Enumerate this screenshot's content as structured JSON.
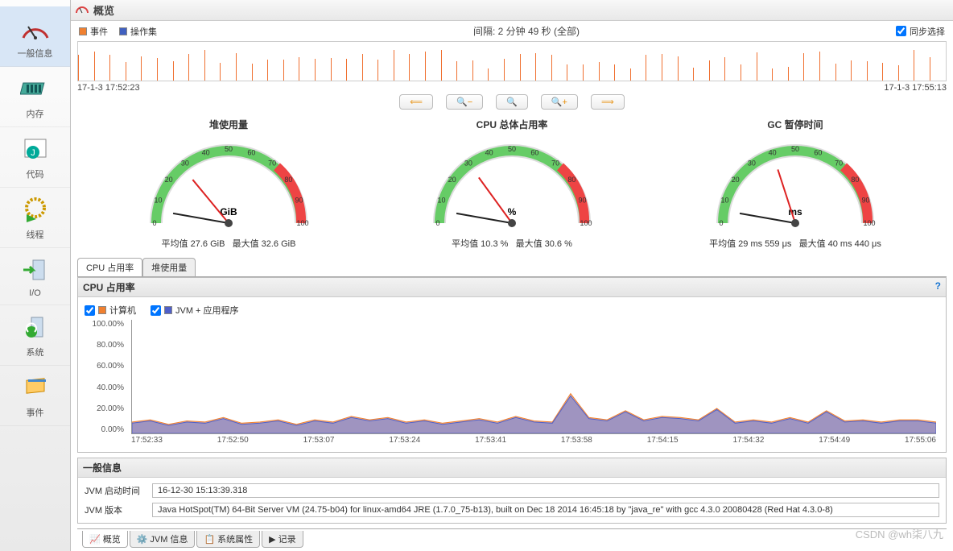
{
  "title": "概览",
  "sidebar": {
    "items": [
      {
        "label": "一般信息"
      },
      {
        "label": "内存"
      },
      {
        "label": "代码"
      },
      {
        "label": "线程"
      },
      {
        "label": "I/O"
      },
      {
        "label": "系统"
      },
      {
        "label": "事件"
      }
    ]
  },
  "legend": {
    "events": "事件",
    "opsets": "操作集",
    "interval": "间隔: 2 分钟 49 秒 (全部)",
    "sync": "同步选择"
  },
  "timeline": {
    "start": "17-1-3 17:52:23",
    "end": "17-1-3 17:55:13"
  },
  "gauges": [
    {
      "title": "堆使用量",
      "unit": "GiB",
      "avg": "平均值 27.6 GiB",
      "max": "最大值 32.6 GiB",
      "needle": 28,
      "max_scale": 100
    },
    {
      "title": "CPU 总体占用率",
      "unit": "%",
      "avg": "平均值 10.3 %",
      "max": "最大值 30.6 %",
      "needle": 30,
      "max_scale": 100
    },
    {
      "title": "GC 暂停时间",
      "unit": "ms",
      "avg": "平均值 29 ms 559 μs",
      "max": "最大值 40 ms 440 μs",
      "needle": 40,
      "max_scale": 100
    }
  ],
  "chart_tabs": [
    {
      "label": "CPU 占用率",
      "active": true
    },
    {
      "label": "堆使用量",
      "active": false
    }
  ],
  "chart_panel": {
    "title": "CPU 占用率",
    "series_labels": {
      "computer": "计算机",
      "jvm": "JVM + 应用程序"
    }
  },
  "chart_data": {
    "type": "area",
    "title": "CPU 占用率",
    "ylabel": "%",
    "ylim": [
      0,
      100
    ],
    "x_ticks": [
      "17:52:33",
      "17:52:50",
      "17:53:07",
      "17:53:24",
      "17:53:41",
      "17:53:58",
      "17:54:15",
      "17:54:32",
      "17:54:49",
      "17:55:06"
    ],
    "series": [
      {
        "name": "计算机",
        "color": "#f08030",
        "values": [
          10,
          12,
          8,
          11,
          10,
          14,
          9,
          10,
          12,
          8,
          12,
          10,
          15,
          12,
          14,
          10,
          12,
          9,
          11,
          13,
          10,
          15,
          11,
          10,
          35,
          14,
          12,
          20,
          12,
          15,
          14,
          12,
          22,
          10,
          12,
          10,
          14,
          10,
          20,
          11,
          12,
          10,
          12,
          12,
          10
        ]
      },
      {
        "name": "JVM + 应用程序",
        "color": "#5060c8",
        "values": [
          9,
          11,
          7,
          10,
          9,
          13,
          8,
          9,
          11,
          7,
          11,
          9,
          14,
          11,
          13,
          9,
          11,
          8,
          10,
          12,
          9,
          14,
          10,
          9,
          33,
          13,
          11,
          19,
          11,
          14,
          13,
          11,
          21,
          9,
          11,
          9,
          13,
          9,
          19,
          10,
          11,
          9,
          11,
          11,
          9
        ]
      }
    ]
  },
  "general_info": {
    "title": "一般信息",
    "rows": [
      {
        "label": "JVM 启动时间",
        "value": "16-12-30 15:13:39.318"
      },
      {
        "label": "JVM 版本",
        "value": "Java HotSpot(TM) 64-Bit Server VM (24.75-b04) for linux-amd64 JRE (1.7.0_75-b13), built on Dec 18 2014 16:45:18 by \"java_re\" with gcc 4.3.0 20080428 (Red Hat 4.3.0-8)"
      }
    ]
  },
  "bottom_tabs": [
    {
      "label": "概览",
      "active": true
    },
    {
      "label": "JVM 信息",
      "active": false
    },
    {
      "label": "系统属性",
      "active": false
    },
    {
      "label": "记录",
      "active": false
    }
  ],
  "watermark": "CSDN @wh柒八九"
}
